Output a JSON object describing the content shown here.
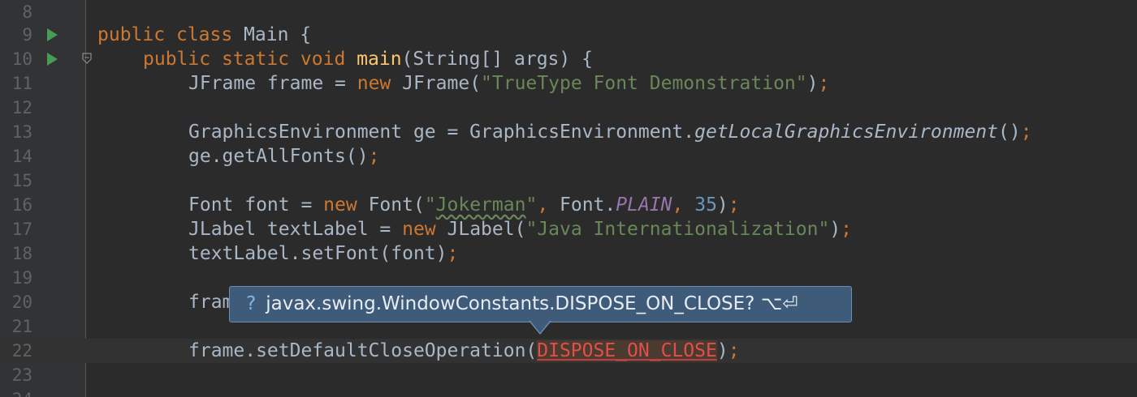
{
  "editor": {
    "line_numbers": [
      "8",
      "9",
      "10",
      "11",
      "12",
      "13",
      "14",
      "15",
      "16",
      "17",
      "18",
      "19",
      "20",
      "21",
      "22",
      "23",
      "24"
    ],
    "code": {
      "l9": {
        "k1": "public",
        "k2": "class",
        "name": " Main {"
      },
      "l10": {
        "k1": "public",
        "k2": "static",
        "k3": "void",
        "method": "main",
        "rest": "(String[] args) {"
      },
      "l11": {
        "a": "JFrame frame = ",
        "kw": "new",
        "b": " JFrame(",
        "str": "\"TrueType Font Demonstration\"",
        "c": ")",
        "semi": ";"
      },
      "l13": {
        "a": "GraphicsEnvironment ge = GraphicsEnvironment.",
        "call": "getLocalGraphicsEnvironment",
        "b": "()",
        "semi": ";"
      },
      "l14": {
        "a": "ge.getAllFonts()",
        "semi": ";"
      },
      "l16": {
        "a": "Font font = ",
        "kw": "new",
        "b": " Font(",
        "q1": "\"",
        "typo": "Jokerman",
        "q2": "\"",
        "comma": ",",
        "c": " Font.",
        "const": "PLAIN",
        "comma2": ",",
        "num": " 35",
        "d": ")",
        "semi": ";"
      },
      "l17": {
        "a": "JLabel textLabel = ",
        "kw": "new",
        "b": " JLabel(",
        "str": "\"Java Internationalization\"",
        "c": ")",
        "semi": ";"
      },
      "l18": {
        "a": "textLabel.setFont(font)",
        "semi": ";"
      },
      "l20": {
        "a": "fram"
      },
      "l22": {
        "a": "frame.setDefaultCloseOperation(",
        "err": "DISPOSE_ON_CLOSE",
        "b": ")",
        "semi": ";"
      }
    }
  },
  "popup": {
    "icon": "?",
    "text": "javax.swing.WindowConstants.DISPOSE_ON_CLOSE? ⌥⏎"
  }
}
